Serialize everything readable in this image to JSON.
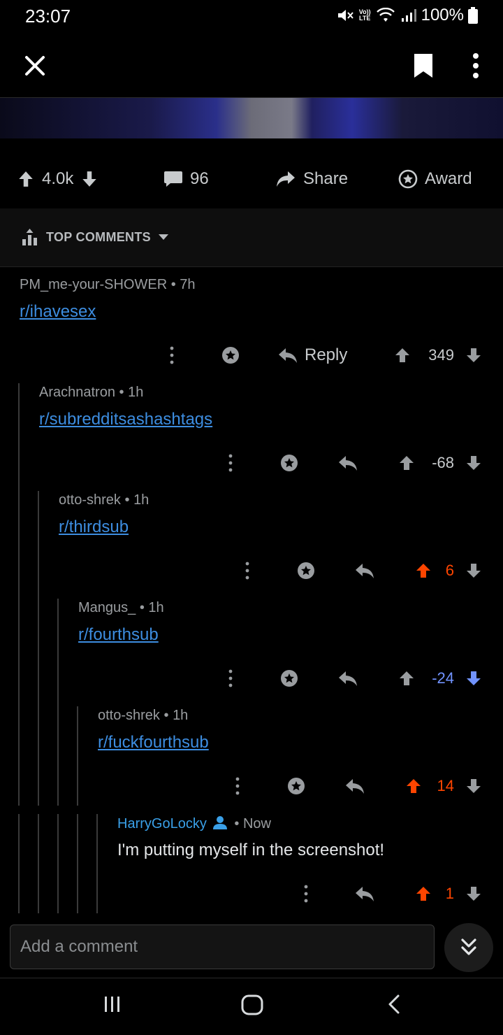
{
  "status_bar": {
    "time": "23:07",
    "volte_top": "Vo))",
    "volte_bottom": "LTE",
    "battery": "100%"
  },
  "post_actions": {
    "score": "4.0k",
    "comments": "96",
    "share": "Share",
    "award": "Award"
  },
  "sort": {
    "label": "TOP COMMENTS"
  },
  "comments": [
    {
      "author": "PM_me-your-SHOWER",
      "age": "7h",
      "body": "r/ihavesex",
      "score": "349",
      "vote": "none",
      "reply_label": "Reply"
    },
    {
      "author": "Arachnatron",
      "age": "1h",
      "body": "r/subredditsashashtags",
      "score": "-68",
      "vote": "none"
    },
    {
      "author": "otto-shrek",
      "age": "1h",
      "body": "r/thirdsub",
      "score": "6",
      "vote": "up"
    },
    {
      "author": "Mangus_",
      "age": "1h",
      "body": "r/fourthsub",
      "score": "-24",
      "vote": "down"
    },
    {
      "author": "otto-shrek",
      "age": "1h",
      "body": "r/fuckfourthsub",
      "score": "14",
      "vote": "up"
    },
    {
      "author": "HarryGoLocky",
      "age": "Now",
      "body": "I'm putting myself in the screenshot!",
      "score": "1",
      "vote": "up",
      "is_op_user": true
    }
  ],
  "comment_input": {
    "placeholder": "Add a comment"
  },
  "colors": {
    "upvote": "#ff4500",
    "downvote": "#7193ff",
    "link": "#3d8de0",
    "user_badge": "#3aa0e8"
  }
}
